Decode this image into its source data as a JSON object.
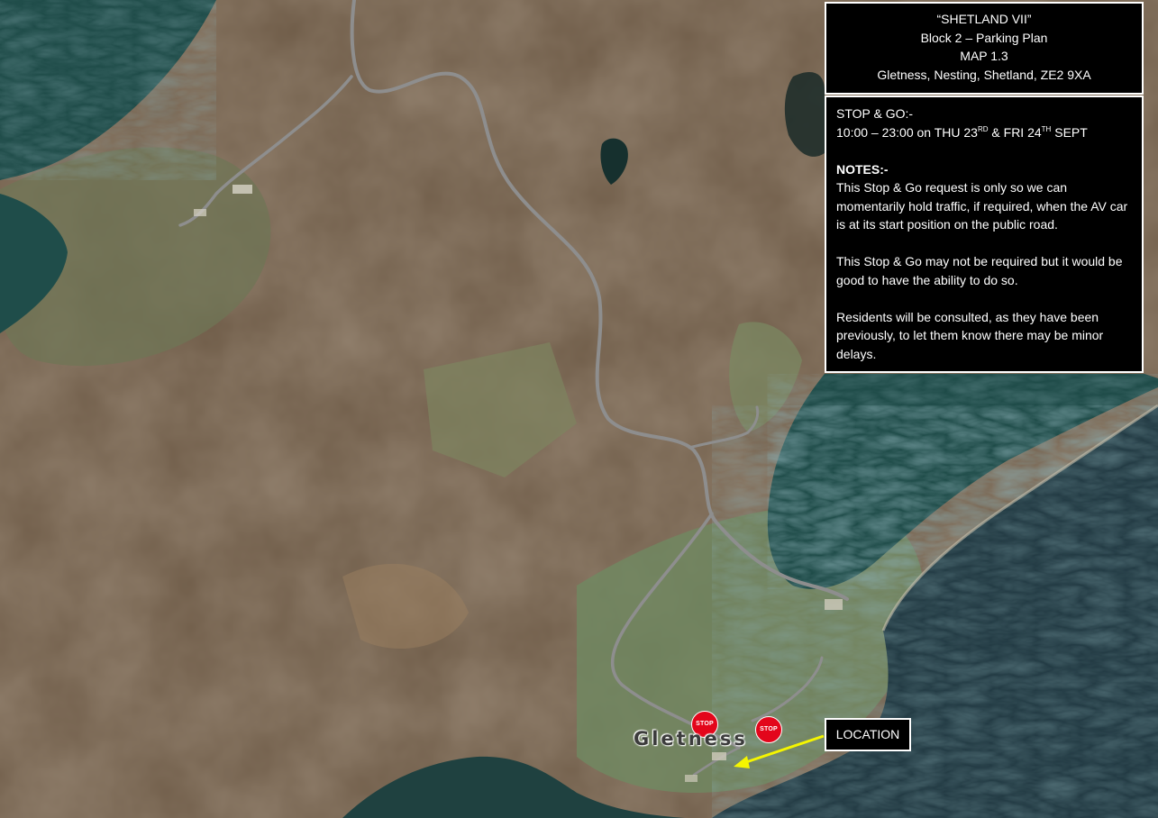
{
  "title_box": {
    "line1": "“SHETLAND VII”",
    "line2": "Block 2 – Parking Plan",
    "line3": "MAP 1.3",
    "line4": "Gletness, Nesting, Shetland, ZE2 9XA"
  },
  "notes_box": {
    "stop_go_heading": "STOP & GO:-",
    "time_a": "10:00 – 23:00 on THU 23",
    "sup_a": "RD",
    "time_b": " & FRI 24",
    "sup_b": "TH",
    "time_c": " SEPT",
    "notes_heading": "NOTES:-",
    "para1": "This Stop & Go request is only so we can momentarily hold traffic, if required, when the AV car is at its start position on the public road.",
    "para2": "This Stop & Go may not be required but it would be good to have the ability to do so.",
    "para3": "Residents will be consulted, as they have been previously, to let them know there may be minor delays."
  },
  "markers": {
    "stop_1": "STOP",
    "stop_2": "STOP"
  },
  "place_label": "Gletness",
  "location_label": "LOCATION",
  "colors": {
    "land": "#6b5a46",
    "sea": "#1f4e4c",
    "road": "#8f8f8f",
    "stop_marker": "#e3061b",
    "arrow": "#f5f500",
    "panel_bg": "#000000",
    "panel_text": "#ffffff"
  }
}
